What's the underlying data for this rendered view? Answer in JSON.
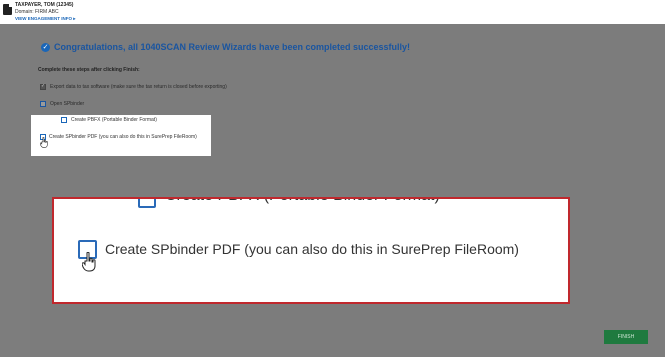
{
  "header": {
    "taxpayer": "TAXPAYER, TOM (12345)",
    "domain": "Domain: FIRM ABC",
    "engagement_link": "VIEW ENGAGEMENT INFO ▸"
  },
  "wizard": {
    "congrats_icon": "check-circle-icon",
    "title": "Congratulations, all 1040SCAN Review Wizards have been completed successfully!",
    "steps_heading": "Complete these steps after clicking Finish:",
    "steps": [
      {
        "label": "Export data to tax software (make sure the tax return is closed before exporting)",
        "checked": true
      },
      {
        "label": "Open SPbinder",
        "checked": false
      },
      {
        "label": "Create PBFX (Portable Binder Format)",
        "checked": false
      },
      {
        "label": "Create SPbinder PDF (you can also do this in SurePrep FileRoom)",
        "checked": false
      }
    ],
    "finish_label": "FINISH"
  },
  "zoom_callout": {
    "prev_label": "Create PBFX (Portable Binder Format)",
    "label": "Create SPbinder PDF (you can also do this in SurePrep FileRoom)",
    "border_color": "#c0282d"
  },
  "colors": {
    "accent": "#1a55a0",
    "finish": "#1f7a3f"
  }
}
